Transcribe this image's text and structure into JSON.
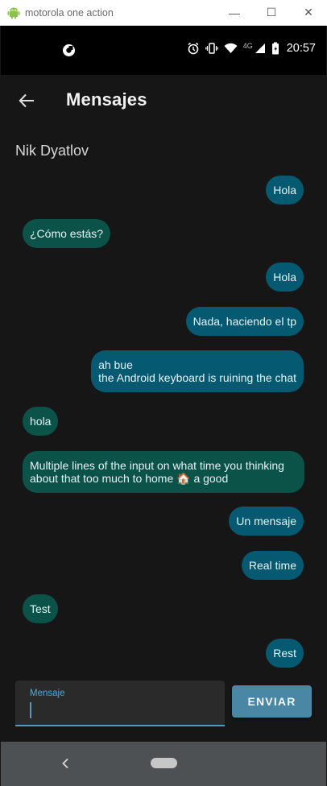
{
  "window": {
    "title": "motorola one action",
    "minimize_icon": "—",
    "maximize_icon": "☐",
    "close_icon": "✕"
  },
  "status_bar": {
    "network_type": "4G",
    "time": "20:57"
  },
  "app_bar": {
    "title": "Mensajes"
  },
  "chat": {
    "contact_name": "Nik Dyatlov",
    "messages": [
      {
        "direction": "out",
        "text": "Hola"
      },
      {
        "direction": "in",
        "text": "¿Cómo estás?"
      },
      {
        "direction": "out",
        "text": "Hola"
      },
      {
        "direction": "out",
        "text": "Nada, haciendo el tp"
      },
      {
        "direction": "out",
        "text": "ah bue\nthe Android keyboard is ruining the chat"
      },
      {
        "direction": "in",
        "text": "hola"
      },
      {
        "direction": "in",
        "text": "Multiple lines of the input on what time you thinking\nabout that too much to home 🏠 a good"
      },
      {
        "direction": "out",
        "text": "Un mensaje"
      },
      {
        "direction": "out",
        "text": "Real time"
      },
      {
        "direction": "in",
        "text": "Test"
      },
      {
        "direction": "out",
        "text": "Rest"
      }
    ]
  },
  "composer": {
    "label": "Mensaje",
    "value": "",
    "send_label": "ENVIAR"
  },
  "colors": {
    "outgoing_bubble": "#055a72",
    "incoming_bubble": "#0b5348",
    "accent": "#4a9cc6",
    "send_button": "#4a87a4"
  }
}
